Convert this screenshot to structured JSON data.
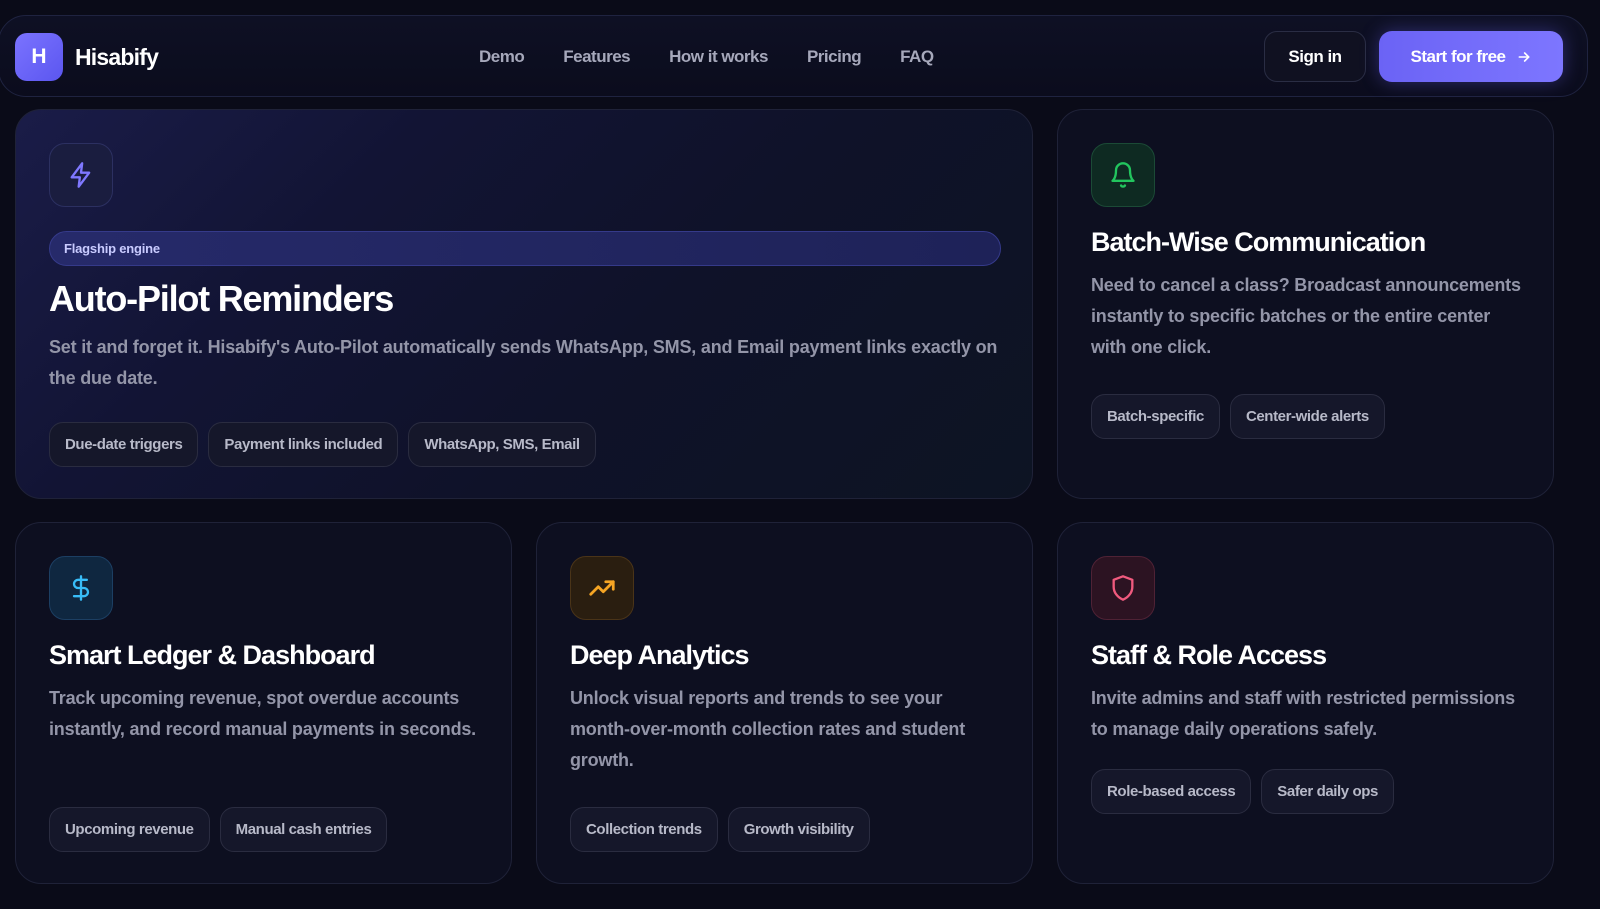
{
  "brand": {
    "logo_letter": "H",
    "name": "Hisabify"
  },
  "nav": {
    "links": [
      "Demo",
      "Features",
      "How it works",
      "Pricing",
      "FAQ"
    ],
    "signin_label": "Sign in",
    "start_label": "Start for free"
  },
  "hero_card": {
    "icon": "lightning-icon",
    "badge": "Flagship engine",
    "title": "Auto-Pilot Reminders",
    "description": "Set it and forget it. Hisabify's Auto-Pilot automatically sends WhatsApp, SMS, and Email payment links exactly on the due date.",
    "tags": [
      "Due-date triggers",
      "Payment links included",
      "WhatsApp, SMS, Email"
    ]
  },
  "batch_card": {
    "icon": "bell-icon",
    "title": "Batch-Wise Communication",
    "description": "Need to cancel a class? Broadcast announcements instantly to specific batches or the entire center with one click.",
    "tags": [
      "Batch-specific",
      "Center-wide alerts"
    ]
  },
  "ledger_card": {
    "icon": "dollar-icon",
    "title": "Smart Ledger & Dashboard",
    "description": "Track upcoming revenue, spot overdue accounts instantly, and record manual payments in seconds.",
    "tags": [
      "Upcoming revenue",
      "Manual cash entries"
    ]
  },
  "analytics_card": {
    "icon": "trending-up-icon",
    "title": "Deep Analytics",
    "description": "Unlock visual reports and trends to see your month-over-month collection rates and student growth.",
    "tags": [
      "Collection trends",
      "Growth visibility"
    ]
  },
  "staff_card": {
    "icon": "shield-icon",
    "title": "Staff & Role Access",
    "description": "Invite admins and staff with restricted permissions to manage daily operations safely.",
    "tags": [
      "Role-based access",
      "Safer daily ops"
    ]
  },
  "colors": {
    "accent": "#6b63f5",
    "green": "#22c55e",
    "blue": "#38bdf8",
    "amber": "#f5a524",
    "red": "#f05a7e"
  }
}
